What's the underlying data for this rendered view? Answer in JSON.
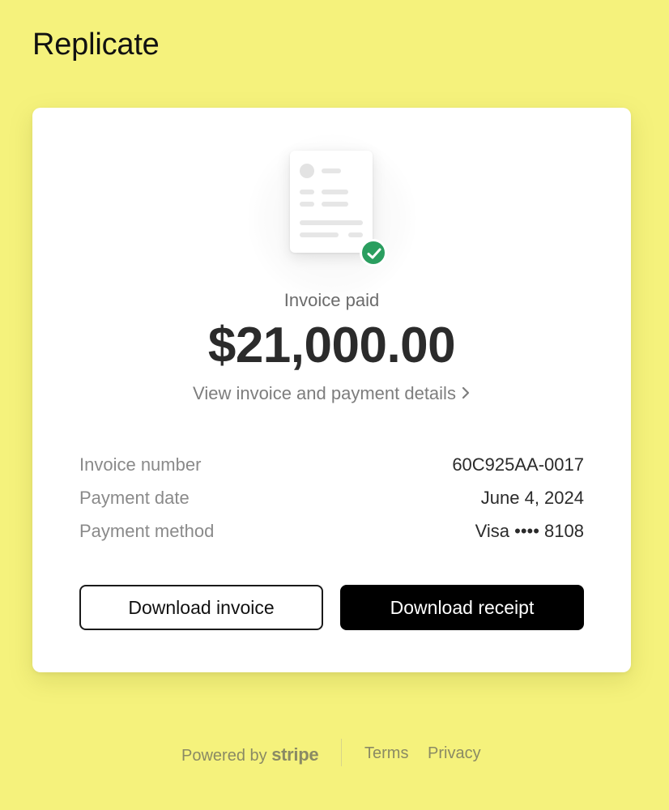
{
  "header": {
    "brand": "Replicate"
  },
  "invoice": {
    "status_label": "Invoice paid",
    "amount": "$21,000.00",
    "details_link": "View invoice and payment details",
    "rows": [
      {
        "label": "Invoice number",
        "value": "60C925AA-0017"
      },
      {
        "label": "Payment date",
        "value": "June 4, 2024"
      },
      {
        "label": "Payment method",
        "value": "Visa •••• 8108"
      }
    ],
    "buttons": {
      "download_invoice": "Download invoice",
      "download_receipt": "Download receipt"
    }
  },
  "footer": {
    "powered_by": "Powered by",
    "stripe": "stripe",
    "terms": "Terms",
    "privacy": "Privacy"
  },
  "colors": {
    "background": "#f5f27c",
    "success": "#2a9e5f",
    "primary_button": "#000000"
  },
  "icons": {
    "illustration": "invoice-document-icon",
    "status": "checkmark-circle-icon",
    "link_chevron": "chevron-right-icon"
  }
}
